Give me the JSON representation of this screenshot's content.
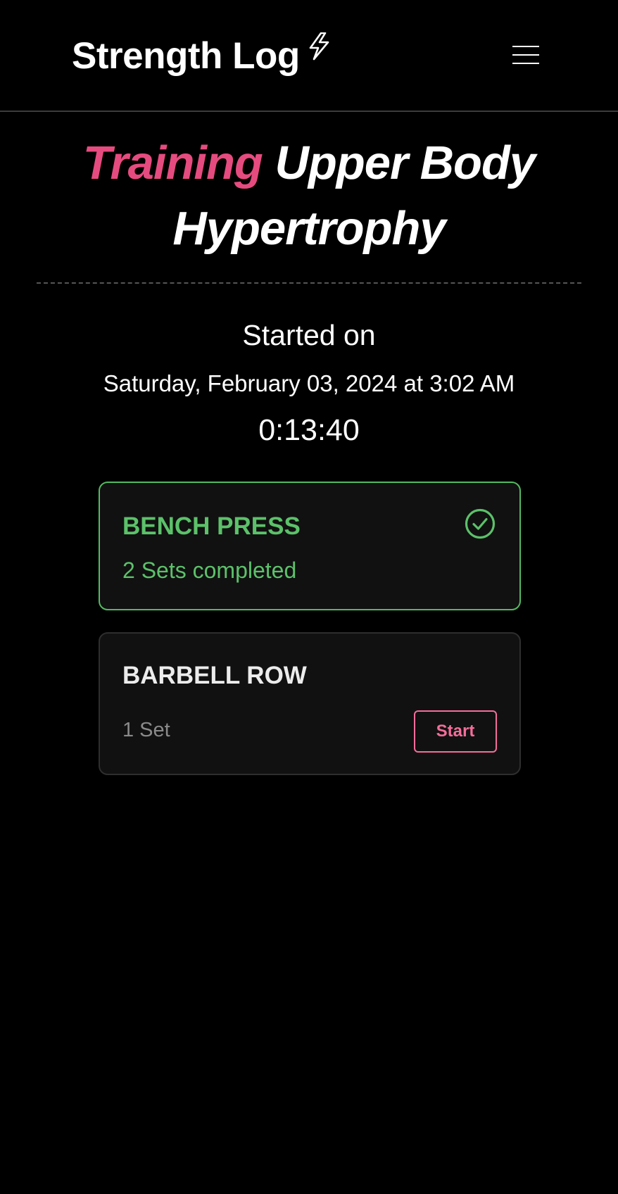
{
  "header": {
    "brand": "Strength Log",
    "brand_icon": "lightning-bolt-icon",
    "menu_icon": "hamburger-menu-icon"
  },
  "workout": {
    "title_prefix": "Training",
    "title_name": "Upper Body Hypertrophy",
    "started_label": "Started on",
    "started_date": "Saturday, February 03, 2024 at 3:02 AM",
    "elapsed": "0:13:40"
  },
  "exercises": [
    {
      "name": "BENCH PRESS",
      "status": "2 Sets completed",
      "status_icon": "check-circle-icon",
      "completed": true
    },
    {
      "name": "BARBELL ROW",
      "sets": "1 Set",
      "action_label": "Start",
      "completed": false
    }
  ],
  "colors": {
    "background": "#000000",
    "accent_pink": "#e64b7f",
    "button_pink": "#f46d9b",
    "success_green": "#5cc16a",
    "card_background": "#111111"
  }
}
